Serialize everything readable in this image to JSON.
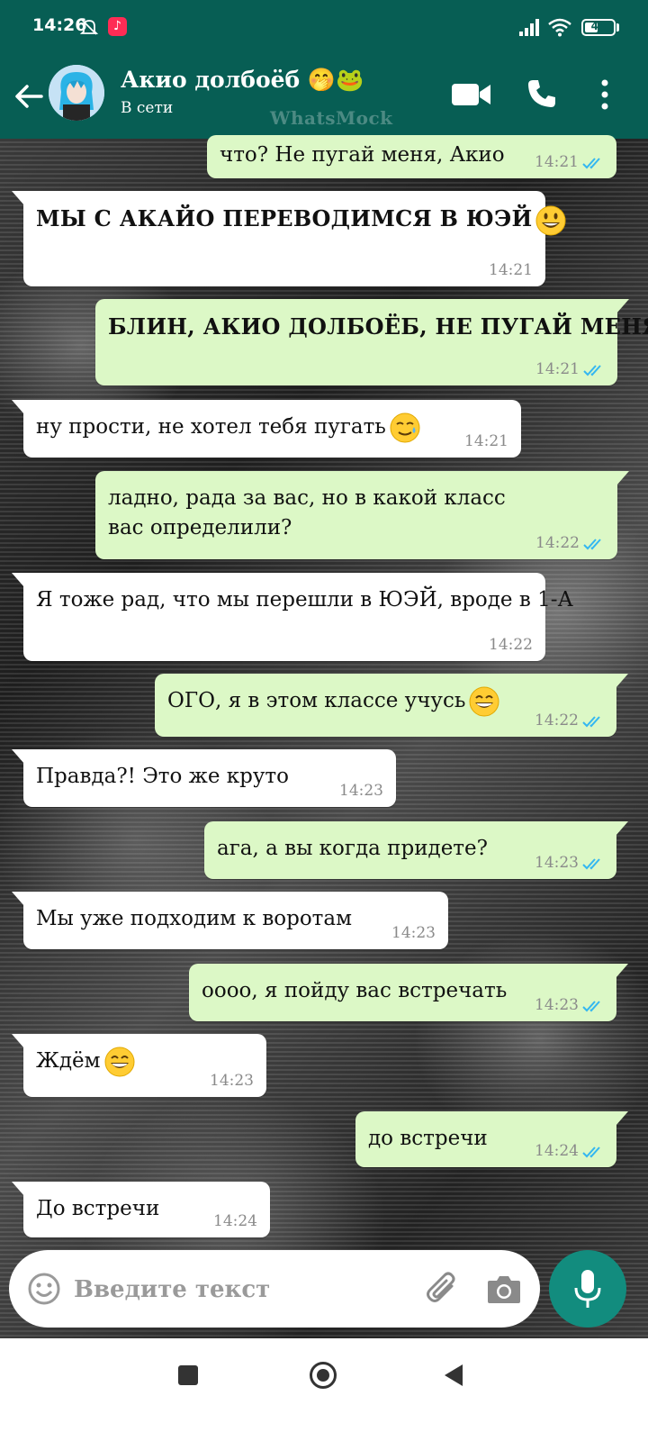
{
  "status_bar": {
    "time": "14:26",
    "battery": "48",
    "battery_level": 0.48
  },
  "header": {
    "contact_name": "Акио долбоёб 🤭🐸",
    "status": "В сети",
    "watermark": "WhatsMock"
  },
  "messages": [
    {
      "dir": "out",
      "text": "что? Не пугай меня, Акио",
      "time": "14:21",
      "read": true
    },
    {
      "dir": "in",
      "text": "МЫ С АКАЙО ПЕРЕВОДИМСЯ В ЮЭЙ",
      "emoji": "grin",
      "time": "14:21"
    },
    {
      "dir": "out",
      "text": "БЛИН, АКИО ДОЛБОЁБ, НЕ ПУГАЙ МЕНЯ!",
      "time": "14:21",
      "read": true
    },
    {
      "dir": "in",
      "text": "ну прости, не хотел тебя пугать",
      "emoji": "tear-smile",
      "time": "14:21"
    },
    {
      "dir": "out",
      "text": "ладно, рада за вас, но в какой класс вас определили?",
      "time": "14:22",
      "read": true
    },
    {
      "dir": "in",
      "text": "Я тоже рад, что мы перешли в ЮЭЙ, вроде в 1-А",
      "time": "14:22"
    },
    {
      "dir": "out",
      "text": "ОГО, я в этом классе учусь",
      "emoji": "beam",
      "time": "14:22",
      "read": true
    },
    {
      "dir": "in",
      "text": "Правда?! Это же круто",
      "time": "14:23"
    },
    {
      "dir": "out",
      "text": "ага, а вы когда придете?",
      "time": "14:23",
      "read": true
    },
    {
      "dir": "in",
      "text": "Мы уже подходим к воротам",
      "time": "14:23"
    },
    {
      "dir": "out",
      "text": "оооо, я пойду вас встречать",
      "time": "14:23",
      "read": true
    },
    {
      "dir": "in",
      "text": "Ждём",
      "emoji": "beam",
      "time": "14:23"
    },
    {
      "dir": "out",
      "text": "до встречи",
      "time": "14:24",
      "read": true
    },
    {
      "dir": "in",
      "text": "До встречи",
      "time": "14:24"
    }
  ],
  "input": {
    "placeholder": "Введите текст"
  },
  "colors": {
    "header": "#075e54",
    "outgoing": "#dcf8c6",
    "incoming": "#ffffff",
    "ticks": "#34b7f1",
    "mic": "#128c7e"
  }
}
